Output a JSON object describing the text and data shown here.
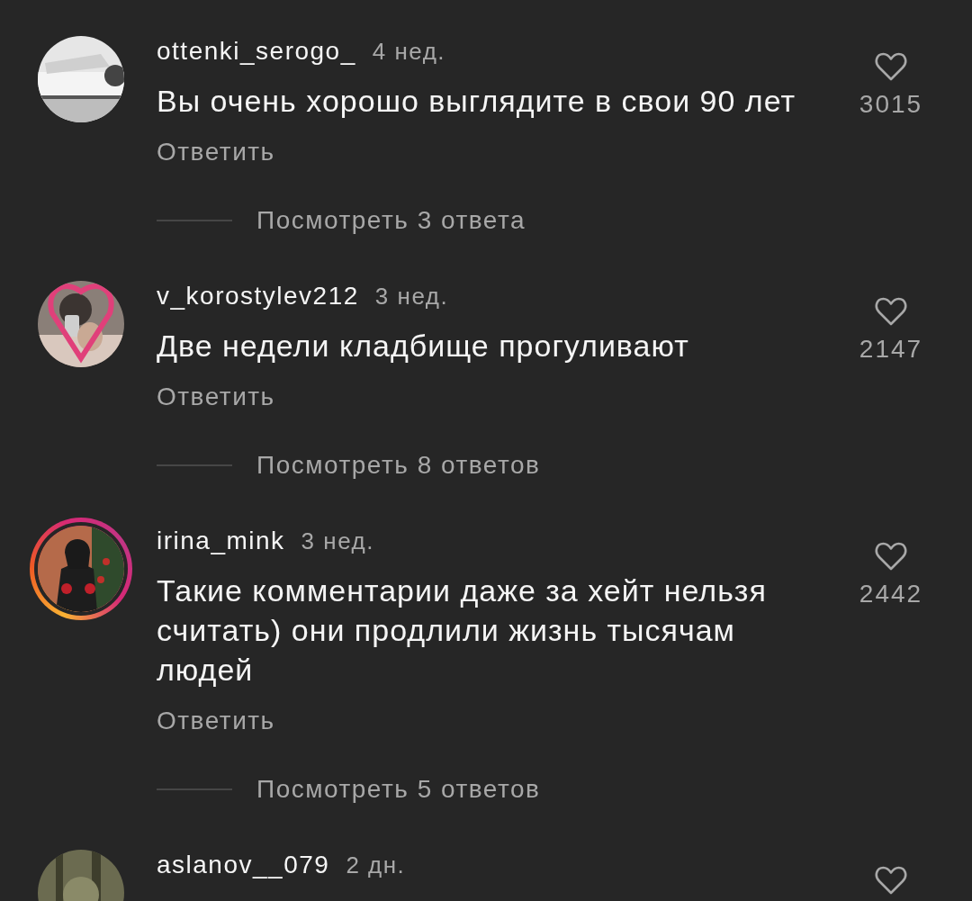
{
  "comments": [
    {
      "username": "ottenki_serogo_",
      "time": "4 нед.",
      "text": "Вы очень хорошо выглядите в свои 90 лет",
      "reply": "Ответить",
      "view_replies": "Посмотреть 3 ответа",
      "likes": "3015",
      "liked": false,
      "has_story": false
    },
    {
      "username": "v_korostylev212",
      "time": "3 нед.",
      "text": "Две недели кладбище прогуливают",
      "reply": "Ответить",
      "view_replies": "Посмотреть 8 ответов",
      "likes": "2147",
      "liked": false,
      "has_story": false
    },
    {
      "username": "irina_mink",
      "time": "3 нед.",
      "text": "Такие комментарии даже за хейт нельзя считать) они продлили жизнь тысячам людей",
      "reply": "Ответить",
      "view_replies": "Посмотреть 5 ответов",
      "likes": "2442",
      "liked": false,
      "has_story": true
    },
    {
      "username": "aslanov__079",
      "time": "2 дн.",
      "liked": false,
      "has_story": false
    }
  ]
}
